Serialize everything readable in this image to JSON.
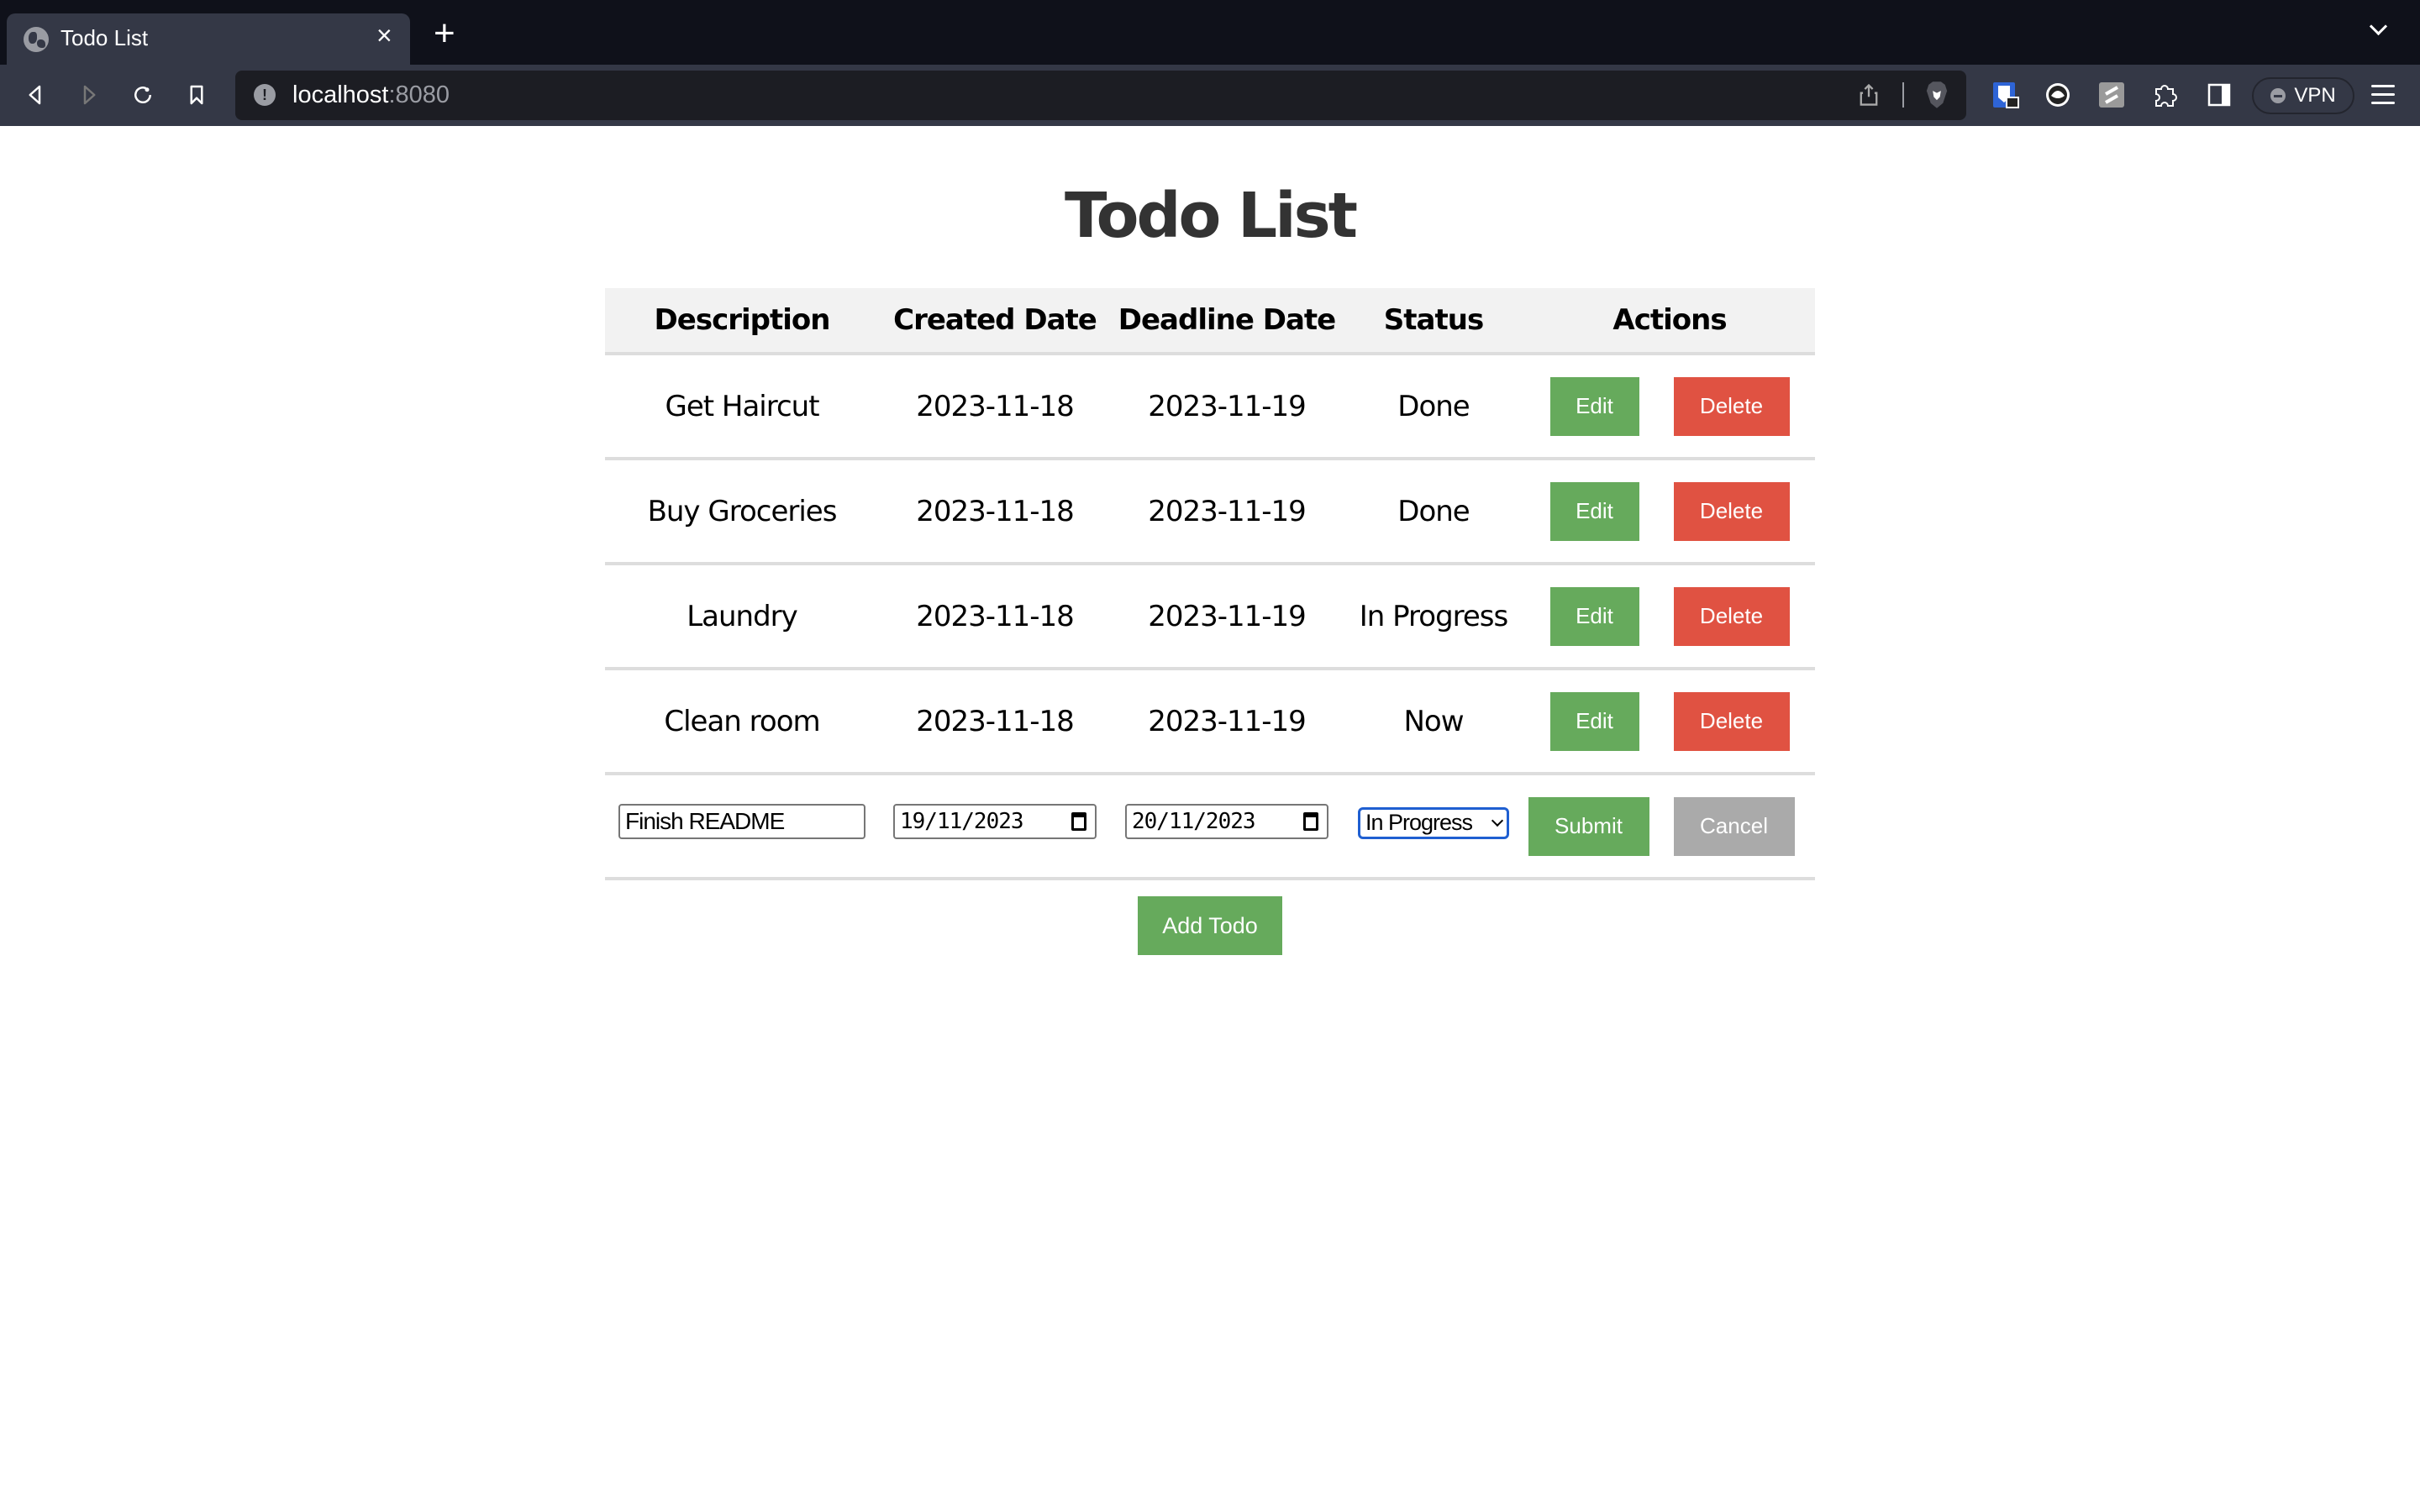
{
  "browser": {
    "tab_title": "Todo List",
    "url_host": "localhost",
    "url_port": ":8080",
    "vpn_label": "VPN"
  },
  "page": {
    "title": "Todo List",
    "columns": [
      "Description",
      "Created Date",
      "Deadline Date",
      "Status",
      "Actions"
    ],
    "todos": [
      {
        "description": "Get Haircut",
        "created": "2023-11-18",
        "deadline": "2023-11-19",
        "status": "Done"
      },
      {
        "description": "Buy Groceries",
        "created": "2023-11-18",
        "deadline": "2023-11-19",
        "status": "Done"
      },
      {
        "description": "Laundry",
        "created": "2023-11-18",
        "deadline": "2023-11-19",
        "status": "In Progress"
      },
      {
        "description": "Clean room",
        "created": "2023-11-18",
        "deadline": "2023-11-19",
        "status": "Now"
      }
    ],
    "row_actions": {
      "edit_label": "Edit",
      "delete_label": "Delete"
    },
    "form": {
      "description_value": "Finish README",
      "created_value": "19/11/2023",
      "deadline_value": "20/11/2023",
      "status_value": "In Progress",
      "submit_label": "Submit",
      "cancel_label": "Cancel"
    },
    "add_label": "Add Todo"
  },
  "colors": {
    "edit": "#66aa5c",
    "delete": "#e05242",
    "cancel": "#aaaaaa",
    "header_bg": "#f2f2f2"
  }
}
